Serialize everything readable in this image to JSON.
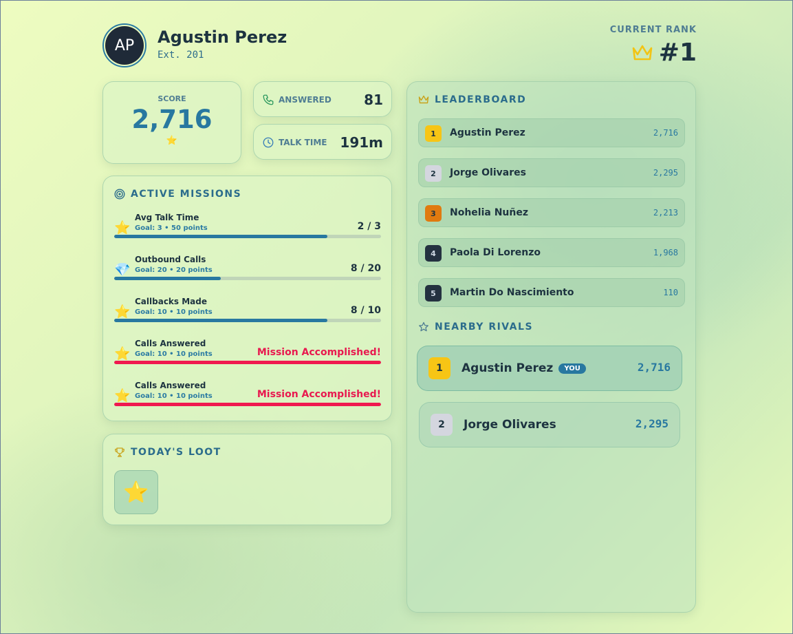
{
  "user": {
    "initials": "AP",
    "name": "Agustin Perez",
    "extension": "Ext. 201"
  },
  "rank": {
    "label": "CURRENT RANK",
    "value": "#1",
    "icon": "crown-icon"
  },
  "score": {
    "label": "SCORE",
    "value": "2,716",
    "icon": "star"
  },
  "stats": {
    "answered": {
      "label": "ANSWERED",
      "value": "81",
      "icon": "phone-icon"
    },
    "talk_time": {
      "label": "TALK TIME",
      "value": "191m",
      "icon": "clock-icon"
    }
  },
  "missions": {
    "title": "ACTIVE MISSIONS",
    "items": [
      {
        "icon": "⭐",
        "name": "Avg Talk Time",
        "goal": "Goal: 3 • 50 points",
        "progress": "2 / 3",
        "fraction": 0.8,
        "completed": false
      },
      {
        "icon": "💎",
        "name": "Outbound Calls",
        "goal": "Goal: 20 • 20 points",
        "progress": "8 / 20",
        "fraction": 0.4,
        "completed": false
      },
      {
        "icon": "⭐",
        "name": "Callbacks Made",
        "goal": "Goal: 10 • 10 points",
        "progress": "8 / 10",
        "fraction": 0.8,
        "completed": false
      },
      {
        "icon": "⭐",
        "name": "Calls Answered",
        "goal": "Goal: 10 • 10 points",
        "progress": "Mission Accomplished!",
        "fraction": 1.0,
        "completed": true
      },
      {
        "icon": "⭐",
        "name": "Calls Answered",
        "goal": "Goal: 10 • 10 points",
        "progress": "Mission Accomplished!",
        "fraction": 1.0,
        "completed": true
      }
    ]
  },
  "loot": {
    "title": "TODAY'S LOOT",
    "items": [
      "⭐"
    ]
  },
  "leaderboard": {
    "title": "LEADERBOARD",
    "rows": [
      {
        "rank": "1",
        "name": "Agustin Perez",
        "score": "2,716"
      },
      {
        "rank": "2",
        "name": "Jorge Olivares",
        "score": "2,295"
      },
      {
        "rank": "3",
        "name": "Nohelia Nuñez",
        "score": "2,213"
      },
      {
        "rank": "4",
        "name": "Paola Di Lorenzo",
        "score": "1,968"
      },
      {
        "rank": "5",
        "name": "Martin Do Nascimiento",
        "score": "110"
      }
    ]
  },
  "rivals": {
    "title": "NEARBY RIVALS",
    "you_label": "YOU",
    "me": {
      "rank": "1",
      "name": "Agustin Perez",
      "score": "2,716"
    },
    "other": {
      "rank": "2",
      "name": "Jorge Olivares",
      "score": "2,295"
    }
  },
  "colors": {
    "accent": "#2878a0",
    "danger": "#e8194f",
    "gold": "#f7c515",
    "silver": "#d4d6df",
    "bronze": "#e07a0f"
  }
}
